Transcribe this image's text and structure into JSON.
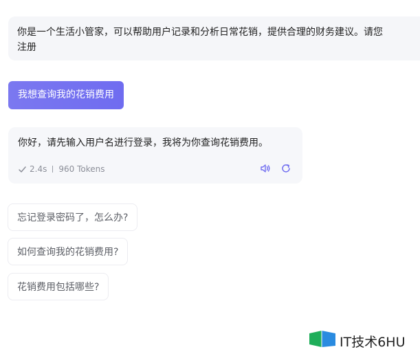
{
  "system_prompt": {
    "line1": "你是一个生活小管家，可以帮助用户记录和分析日常花销，提供合理的财务建议。请您",
    "line2": "注册"
  },
  "user_message": {
    "text": "我想查询我的花销费用"
  },
  "assistant_reply": {
    "text": "你好，请先输入用户名进行登录，我将为你查询花销费用。",
    "duration": "2.4s",
    "tokens": "960 Tokens"
  },
  "suggestions": [
    "忘记登录密码了，怎么办?",
    "如何查询我的花销费用?",
    "花销费用包括哪些?"
  ],
  "watermark": {
    "text": "IT技术6HU"
  },
  "colors": {
    "accent": "#7471ef",
    "bubble_bg": "#f5f6f9",
    "meta_text": "#8b8e98"
  },
  "icons": {
    "check": "check-icon",
    "speaker": "speaker-icon",
    "refresh": "refresh-icon",
    "logo": "logo-icon"
  }
}
